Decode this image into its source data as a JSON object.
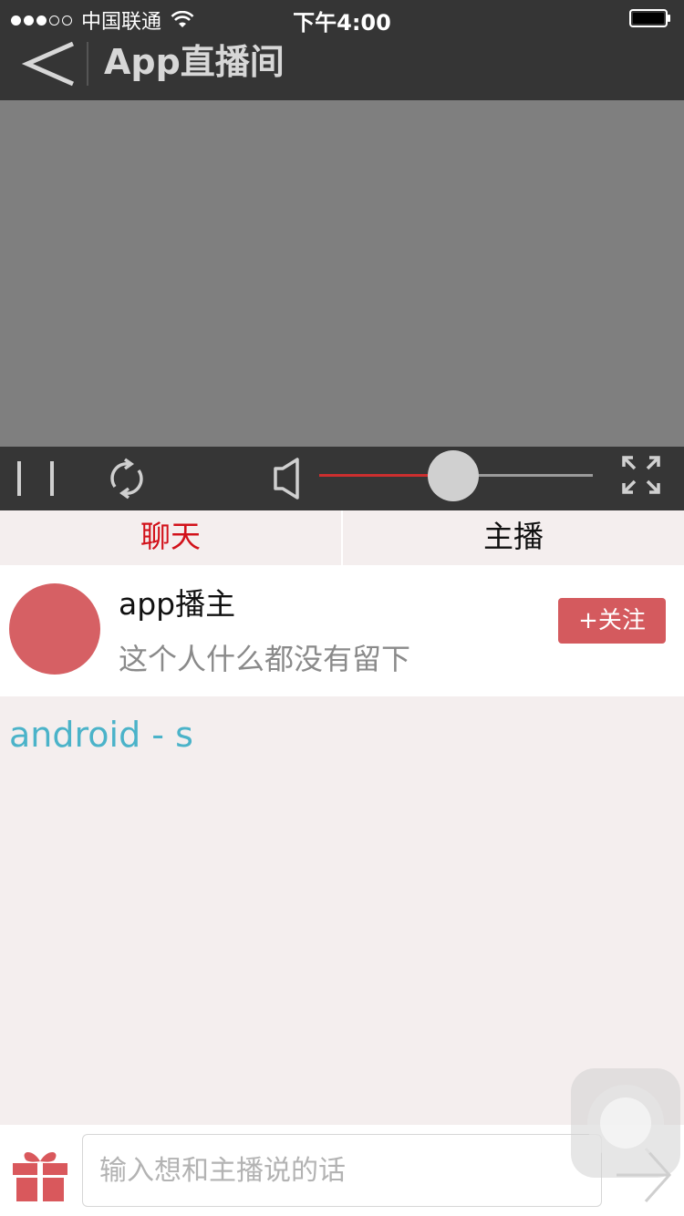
{
  "status_bar": {
    "carrier": "中国联通",
    "time": "下午4:00"
  },
  "header": {
    "title": "App直播间",
    "back_icon": "chevron-left-icon"
  },
  "player": {
    "volume_level": 0.49,
    "icons": {
      "pause": "pause-icon",
      "refresh": "refresh-icon",
      "volume": "speaker-icon",
      "fullscreen": "fullscreen-icon"
    }
  },
  "tabs": [
    {
      "label": "聊天",
      "active": true
    },
    {
      "label": "主播",
      "active": false
    }
  ],
  "host": {
    "name": "app播主",
    "bio": "这个人什么都没有留下",
    "follow_label": "+关注"
  },
  "chat": {
    "messages": [
      "android - s"
    ]
  },
  "input_bar": {
    "placeholder": "输入想和主播说的话",
    "value": "",
    "gift_icon": "gift-icon",
    "send_icon": "send-arrow-icon"
  },
  "colors": {
    "header_bg": "#353535",
    "accent_red": "#d2111a",
    "follow_button": "#d45a5e",
    "chat_text": "#4bb3c9",
    "slider_fill": "#cc2f2f"
  }
}
